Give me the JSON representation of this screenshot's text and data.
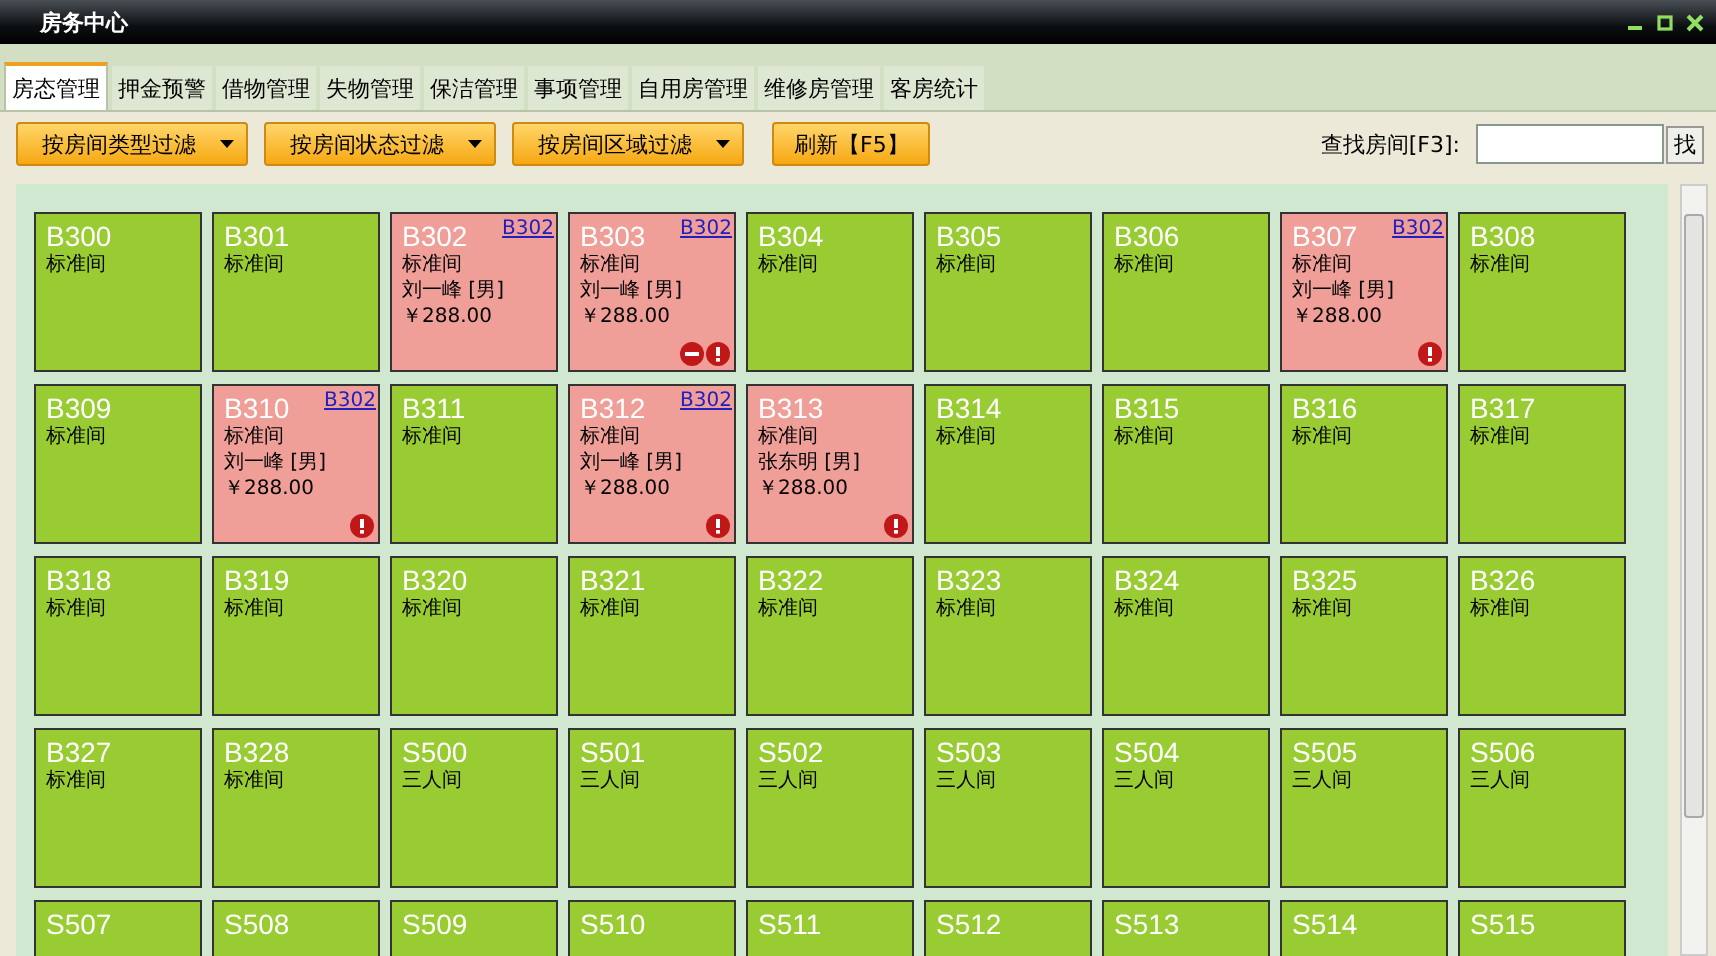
{
  "window": {
    "title": "房务中心"
  },
  "tabs": [
    {
      "label": "房态管理",
      "selected": true
    },
    {
      "label": "押金预警",
      "selected": false
    },
    {
      "label": "借物管理",
      "selected": false
    },
    {
      "label": "失物管理",
      "selected": false
    },
    {
      "label": "保洁管理",
      "selected": false
    },
    {
      "label": "事项管理",
      "selected": false
    },
    {
      "label": "自用房管理",
      "selected": false
    },
    {
      "label": "维修房管理",
      "selected": false
    },
    {
      "label": "客房统计",
      "selected": false
    }
  ],
  "filters": [
    {
      "label": "按房间类型过滤",
      "kind": "dropdown"
    },
    {
      "label": "按房间状态过滤",
      "kind": "dropdown"
    },
    {
      "label": "按房间区域过滤",
      "kind": "dropdown"
    },
    {
      "label": "刷新【F5】",
      "kind": "button"
    }
  ],
  "search": {
    "label": "查找房间[F3]:",
    "button": "找"
  },
  "rooms": [
    {
      "name": "B300",
      "type": "标准间",
      "occupied": false
    },
    {
      "name": "B301",
      "type": "标准间",
      "occupied": false
    },
    {
      "name": "B302",
      "type": "标准间",
      "occupied": true,
      "link": "B302",
      "guest": "刘一峰 [男]",
      "price": "￥288.00",
      "blocked": false,
      "warning": false
    },
    {
      "name": "B303",
      "type": "标准间",
      "occupied": true,
      "link": "B302",
      "guest": "刘一峰 [男]",
      "price": "￥288.00",
      "blocked": true,
      "warning": true
    },
    {
      "name": "B304",
      "type": "标准间",
      "occupied": false
    },
    {
      "name": "B305",
      "type": "标准间",
      "occupied": false
    },
    {
      "name": "B306",
      "type": "标准间",
      "occupied": false
    },
    {
      "name": "B307",
      "type": "标准间",
      "occupied": true,
      "link": "B302",
      "guest": "刘一峰 [男]",
      "price": "￥288.00",
      "blocked": false,
      "warning": true
    },
    {
      "name": "B308",
      "type": "标准间",
      "occupied": false
    },
    {
      "name": "B309",
      "type": "标准间",
      "occupied": false
    },
    {
      "name": "B310",
      "type": "标准间",
      "occupied": true,
      "link": "B302",
      "guest": "刘一峰 [男]",
      "price": "￥288.00",
      "blocked": false,
      "warning": true
    },
    {
      "name": "B311",
      "type": "标准间",
      "occupied": false
    },
    {
      "name": "B312",
      "type": "标准间",
      "occupied": true,
      "link": "B302",
      "guest": "刘一峰 [男]",
      "price": "￥288.00",
      "blocked": false,
      "warning": true
    },
    {
      "name": "B313",
      "type": "标准间",
      "occupied": true,
      "guest": "张东明 [男]",
      "price": "￥288.00",
      "blocked": false,
      "warning": true
    },
    {
      "name": "B314",
      "type": "标准间",
      "occupied": false
    },
    {
      "name": "B315",
      "type": "标准间",
      "occupied": false
    },
    {
      "name": "B316",
      "type": "标准间",
      "occupied": false
    },
    {
      "name": "B317",
      "type": "标准间",
      "occupied": false
    },
    {
      "name": "B318",
      "type": "标准间",
      "occupied": false
    },
    {
      "name": "B319",
      "type": "标准间",
      "occupied": false
    },
    {
      "name": "B320",
      "type": "标准间",
      "occupied": false
    },
    {
      "name": "B321",
      "type": "标准间",
      "occupied": false
    },
    {
      "name": "B322",
      "type": "标准间",
      "occupied": false
    },
    {
      "name": "B323",
      "type": "标准间",
      "occupied": false
    },
    {
      "name": "B324",
      "type": "标准间",
      "occupied": false
    },
    {
      "name": "B325",
      "type": "标准间",
      "occupied": false
    },
    {
      "name": "B326",
      "type": "标准间",
      "occupied": false
    },
    {
      "name": "B327",
      "type": "标准间",
      "occupied": false
    },
    {
      "name": "B328",
      "type": "标准间",
      "occupied": false
    },
    {
      "name": "S500",
      "type": "三人间",
      "occupied": false
    },
    {
      "name": "S501",
      "type": "三人间",
      "occupied": false
    },
    {
      "name": "S502",
      "type": "三人间",
      "occupied": false
    },
    {
      "name": "S503",
      "type": "三人间",
      "occupied": false
    },
    {
      "name": "S504",
      "type": "三人间",
      "occupied": false
    },
    {
      "name": "S505",
      "type": "三人间",
      "occupied": false
    },
    {
      "name": "S506",
      "type": "三人间",
      "occupied": false
    },
    {
      "name": "S507",
      "occupied": false
    },
    {
      "name": "S508",
      "occupied": false
    },
    {
      "name": "S509",
      "occupied": false
    },
    {
      "name": "S510",
      "occupied": false
    },
    {
      "name": "S511",
      "occupied": false
    },
    {
      "name": "S512",
      "occupied": false
    },
    {
      "name": "S513",
      "occupied": false
    },
    {
      "name": "S514",
      "occupied": false
    },
    {
      "name": "S515",
      "occupied": false
    }
  ]
}
